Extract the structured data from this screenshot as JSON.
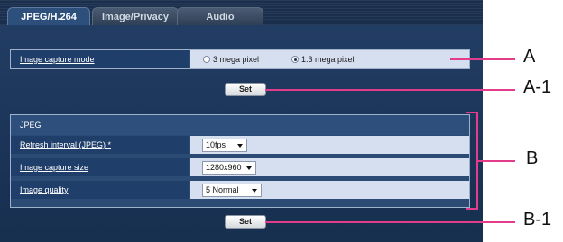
{
  "tabs": [
    {
      "label": "JPEG/H.264",
      "active": true
    },
    {
      "label": "Image/Privacy",
      "active": false
    },
    {
      "label": "Audio",
      "active": false
    }
  ],
  "capture": {
    "label": "Image capture mode",
    "options": [
      {
        "label": "3 mega pixel",
        "checked": false
      },
      {
        "label": "1.3 mega pixel",
        "checked": true
      }
    ],
    "set_label": "Set"
  },
  "jpeg": {
    "section_title": "JPEG",
    "rows": [
      {
        "label": "Refresh interval (JPEG) *",
        "value": "10fps"
      },
      {
        "label": "Image capture size",
        "value": "1280x960"
      },
      {
        "label": "Image quality",
        "value": "5 Normal"
      }
    ],
    "set_label": "Set"
  },
  "annotations": {
    "a": "A",
    "a1": "A-1",
    "b": "B",
    "b1": "B-1"
  },
  "colors": {
    "panel": "#1e3a5f",
    "callout": "#e33c8a",
    "value_bg": "#d6dff0"
  }
}
